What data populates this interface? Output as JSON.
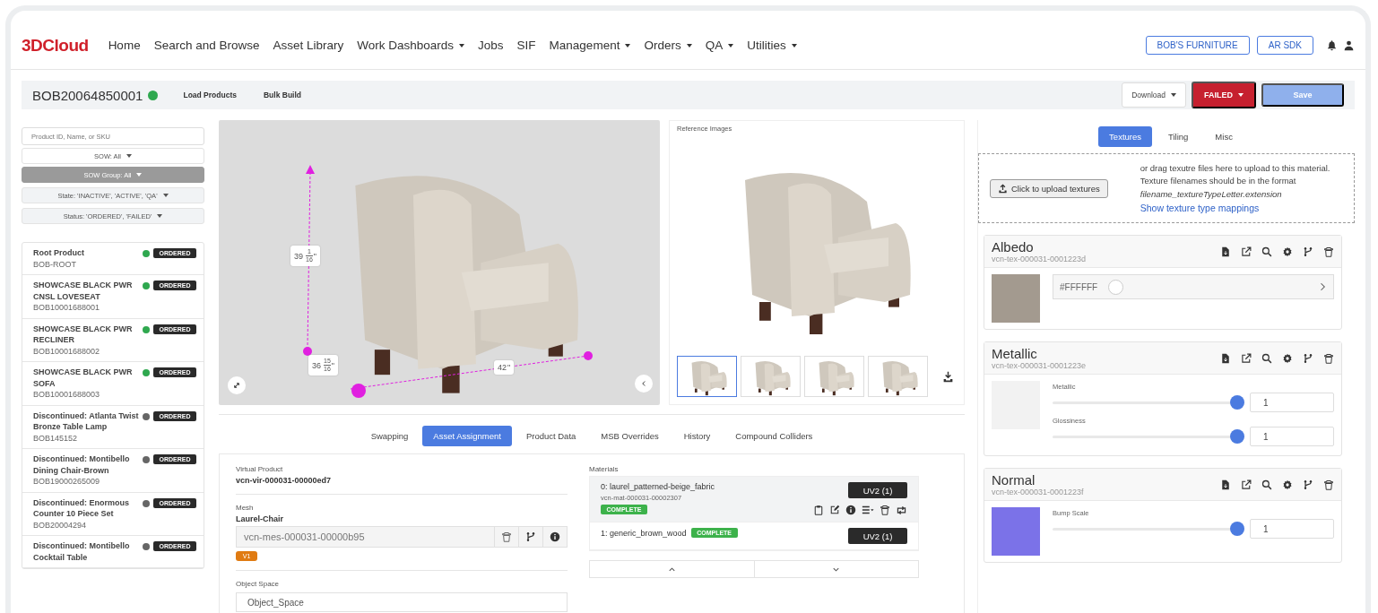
{
  "nav": {
    "logo_primary": "3D",
    "logo_secondary": "Cloud",
    "items": [
      {
        "label": "Home",
        "dropdown": false
      },
      {
        "label": "Search and Browse",
        "dropdown": false
      },
      {
        "label": "Asset Library",
        "dropdown": false
      },
      {
        "label": "Work Dashboards",
        "dropdown": true
      },
      {
        "label": "Jobs",
        "dropdown": false
      },
      {
        "label": "SIF",
        "dropdown": false
      },
      {
        "label": "Management",
        "dropdown": true
      },
      {
        "label": "Orders",
        "dropdown": true
      },
      {
        "label": "QA",
        "dropdown": true
      },
      {
        "label": "Utilities",
        "dropdown": true
      }
    ],
    "buttons": [
      "BOB'S FURNITURE",
      "AR SDK"
    ]
  },
  "header": {
    "product_id": "BOB20064850001",
    "active": true,
    "links": [
      "Load Products",
      "Bulk Build"
    ],
    "download": "Download",
    "status": "FAILED",
    "save": {
      "label": "Save",
      "disabled": true
    }
  },
  "sidebar": {
    "search": {
      "placeholder": "Product ID, Name, or SKU"
    },
    "filters": [
      {
        "label": "SOW: All",
        "active": false
      },
      {
        "label": "SOW Group: All",
        "active": true
      },
      {
        "label": "State: 'INACTIVE', 'ACTIVE', 'QA'",
        "active": false
      },
      {
        "label": "Status: 'ORDERED', 'FAILED'",
        "active": false
      }
    ],
    "products": [
      {
        "name": "Root Product",
        "sku": "BOB-ROOT",
        "color": "#2fa84f",
        "status": "ORDERED"
      },
      {
        "name": "SHOWCASE BLACK PWR CNSL LOVESEAT",
        "sku": "BOB10001688001",
        "color": "#2fa84f",
        "status": "ORDERED"
      },
      {
        "name": "SHOWCASE BLACK PWR RECLINER",
        "sku": "BOB10001688002",
        "color": "#2fa84f",
        "status": "ORDERED"
      },
      {
        "name": "SHOWCASE BLACK PWR SOFA",
        "sku": "BOB10001688003",
        "color": "#2fa84f",
        "status": "ORDERED"
      },
      {
        "name": "Discontinued: Atlanta Twist Bronze Table Lamp",
        "sku": "BOB145152",
        "color": "#666666",
        "status": "ORDERED"
      },
      {
        "name": "Discontinued: Montibello Dining Chair-Brown",
        "sku": "BOB19000265009",
        "color": "#666666",
        "status": "ORDERED"
      },
      {
        "name": "Discontinued: Enormous Counter 10 Piece Set",
        "sku": "BOB20004294",
        "color": "#666666",
        "status": "ORDERED"
      },
      {
        "name": "Discontinued: Montibello Cocktail Table",
        "color": "#666666",
        "status": "ORDERED"
      }
    ]
  },
  "viewer": {
    "measurements": [
      {
        "whole": "39",
        "num": "1",
        "den": "16",
        "unit": "\""
      },
      {
        "whole": "36",
        "num": "15",
        "den": "16",
        "unit": "\""
      },
      {
        "whole": "42",
        "unit": "\""
      }
    ]
  },
  "reference": {
    "title": "Reference Images",
    "thumbnails": [
      {
        "selected": true
      },
      {
        "selected": false
      },
      {
        "selected": false
      },
      {
        "selected": false
      }
    ]
  },
  "tabs": [
    {
      "label": "Swapping",
      "selected": false
    },
    {
      "label": "Asset Assignment",
      "selected": true
    },
    {
      "label": "Product Data",
      "selected": false
    },
    {
      "label": "MSB Overrides",
      "selected": false
    },
    {
      "label": "History",
      "selected": false
    },
    {
      "label": "Compound Colliders",
      "selected": false
    }
  ],
  "assignment": {
    "virtual_product": {
      "label": "Virtual Product",
      "value": "vcn-vir-000031-00000ed7"
    },
    "mesh": {
      "label": "Mesh",
      "name": "Laurel-Chair",
      "id": "vcn-mes-000031-00000b95",
      "version": "V1"
    },
    "object_space": {
      "label": "Object Space",
      "value": "Object_Space"
    },
    "materials_label": "Materials",
    "materials": [
      {
        "name": "0: laurel_patterned-beige_fabric",
        "id": "vcn-mat-000031-00002307",
        "status": "COMPLETE",
        "uv": "UV2 (1)",
        "selected": true
      },
      {
        "name": "1: generic_brown_wood",
        "status": "COMPLETE",
        "uv": "UV2 (1)",
        "selected": false
      }
    ]
  },
  "textures_panel": {
    "tabs": [
      {
        "label": "Textures",
        "selected": true
      },
      {
        "label": "Tiling",
        "selected": false
      },
      {
        "label": "Misc",
        "selected": false
      }
    ],
    "upload": {
      "button": "Click to upload textures",
      "lines": [
        "or drag texutre files here to upload to this material.",
        "Texture filenames should be in the format"
      ],
      "format": "filename_textureTypeLetter.extension",
      "link": "Show texture type mappings"
    },
    "textures": [
      {
        "name": "Albedo",
        "id": "vcn-tex-000031-0001223d",
        "color": "#a39a8f",
        "kind": "color",
        "value": "#FFFFFF"
      },
      {
        "name": "Metallic",
        "id": "vcn-tex-000031-0001223e",
        "color": "#f2f2f2",
        "kind": "sliders",
        "sliders": [
          {
            "label": "Metallic",
            "level": 1,
            "value": "1"
          },
          {
            "label": "Glossiness",
            "level": 1,
            "value": "1"
          }
        ]
      },
      {
        "name": "Normal",
        "id": "vcn-tex-000031-0001223f",
        "color": "#7b72e8",
        "kind": "sliders",
        "sliders": [
          {
            "label": "Bump Scale",
            "level": 1,
            "value": "1"
          }
        ]
      }
    ]
  }
}
